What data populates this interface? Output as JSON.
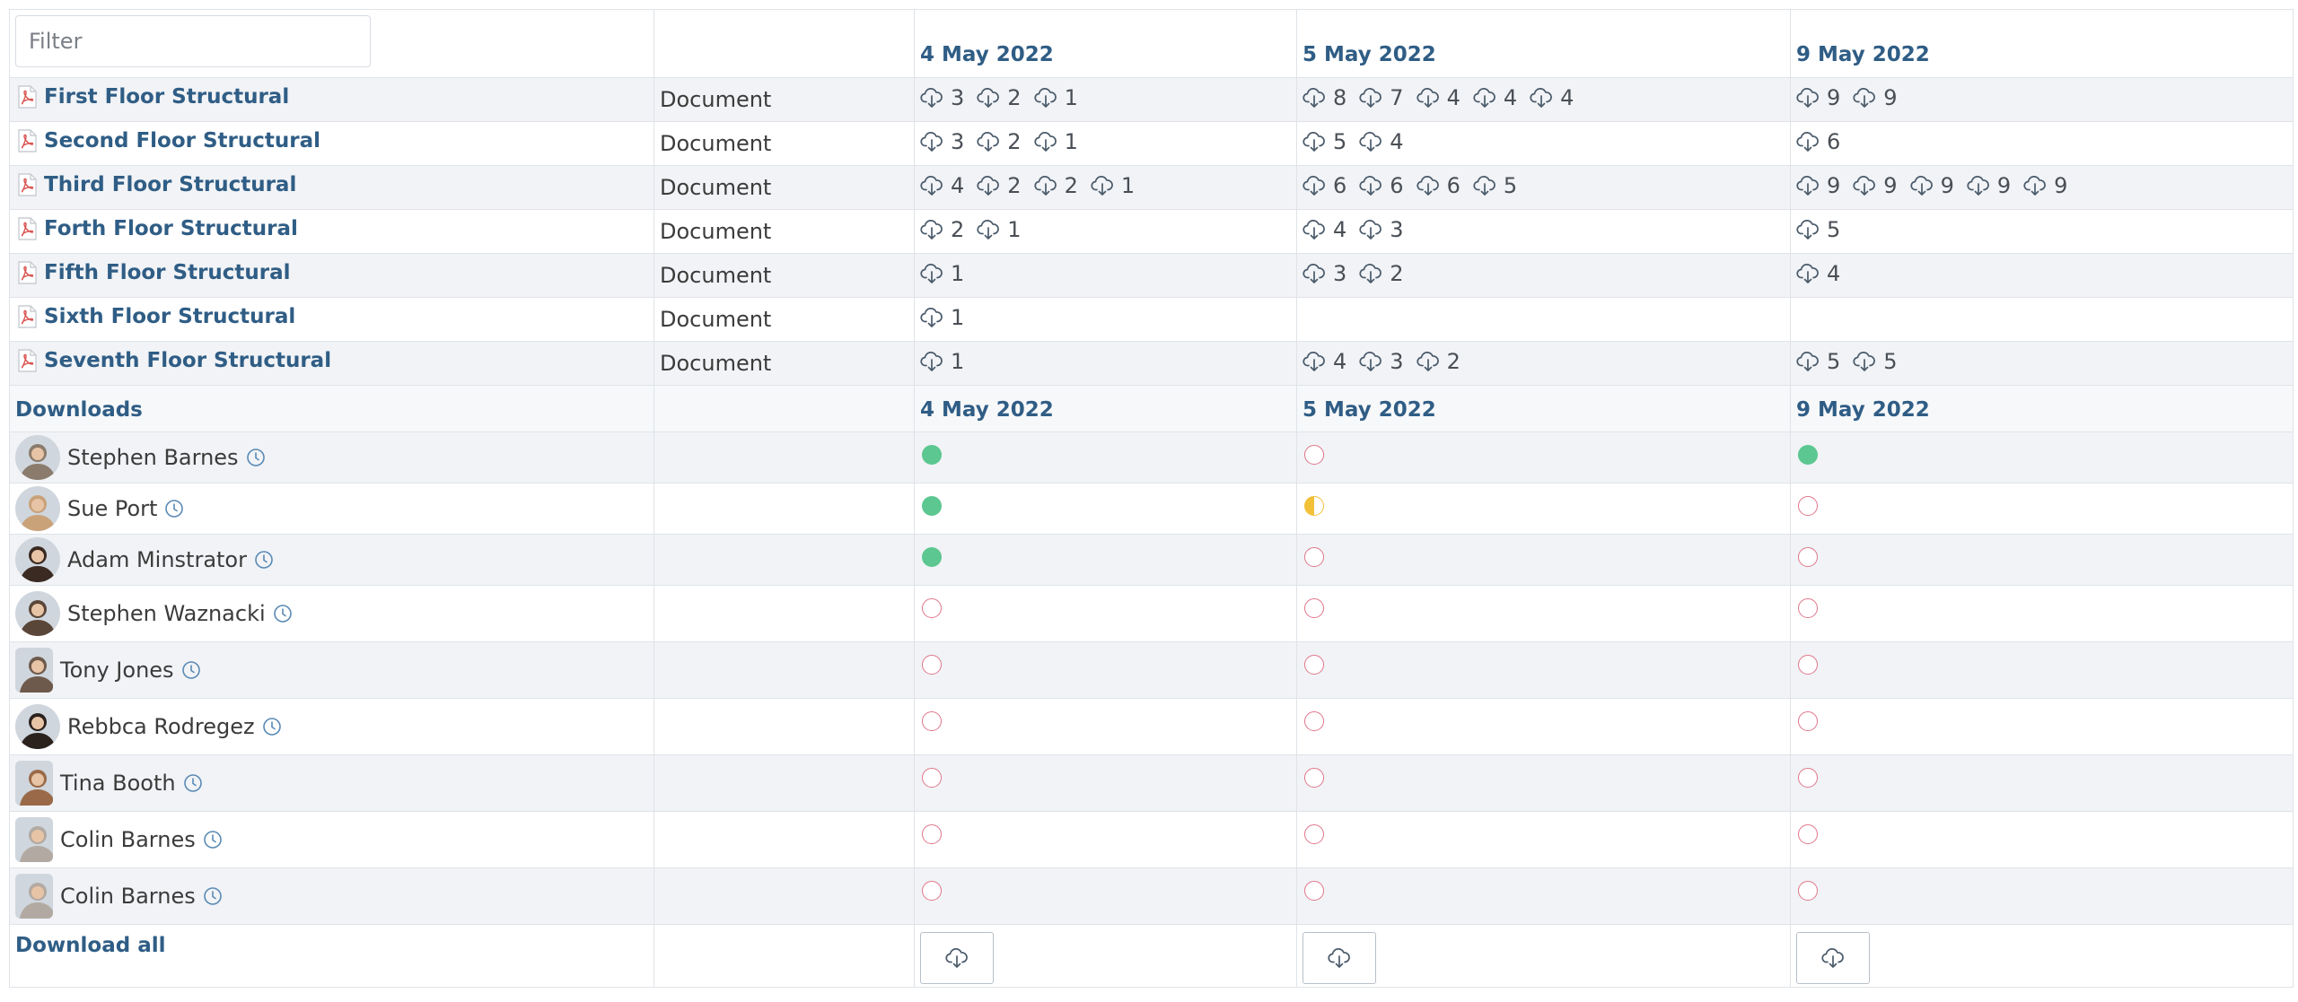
{
  "filter": {
    "placeholder": "Filter"
  },
  "dates": [
    "4 May 2022",
    "5 May 2022",
    "9 May 2022"
  ],
  "documents": [
    {
      "name": "First Floor Structural",
      "type": "Document",
      "downloads": [
        [
          "3",
          "2",
          "1"
        ],
        [
          "8",
          "7",
          "4",
          "4",
          "4"
        ],
        [
          "9",
          "9"
        ]
      ]
    },
    {
      "name": "Second Floor Structural",
      "type": "Document",
      "downloads": [
        [
          "3",
          "2",
          "1"
        ],
        [
          "5",
          "4"
        ],
        [
          "6"
        ]
      ]
    },
    {
      "name": "Third Floor Structural",
      "type": "Document",
      "downloads": [
        [
          "4",
          "2",
          "2",
          "1"
        ],
        [
          "6",
          "6",
          "6",
          "5"
        ],
        [
          "9",
          "9",
          "9",
          "9",
          "9"
        ]
      ]
    },
    {
      "name": "Forth Floor Structural",
      "type": "Document",
      "downloads": [
        [
          "2",
          "1"
        ],
        [
          "4",
          "3"
        ],
        [
          "5"
        ]
      ]
    },
    {
      "name": "Fifth Floor Structural",
      "type": "Document",
      "downloads": [
        [
          "1"
        ],
        [
          "3",
          "2"
        ],
        [
          "4"
        ]
      ]
    },
    {
      "name": "Sixth Floor Structural",
      "type": "Document",
      "downloads": [
        [
          "1"
        ],
        [],
        []
      ]
    },
    {
      "name": "Seventh Floor Structural",
      "type": "Document",
      "downloads": [
        [
          "1"
        ],
        [
          "4",
          "3",
          "2"
        ],
        [
          "5",
          "5"
        ]
      ]
    }
  ],
  "downloads_label": "Downloads",
  "users": [
    {
      "name": "Stephen Barnes",
      "avatar_color": "#8a7b6c",
      "status": [
        "full",
        "empty",
        "full"
      ]
    },
    {
      "name": "Sue Port",
      "avatar_color": "#c9a27a",
      "status": [
        "full",
        "half",
        "empty"
      ]
    },
    {
      "name": "Adam Minstrator",
      "avatar_color": "#3a2a22",
      "status": [
        "full",
        "empty",
        "empty"
      ]
    },
    {
      "name": "Stephen Waznacki",
      "avatar_color": "#5a4638",
      "status": [
        "empty",
        "empty",
        "empty"
      ]
    },
    {
      "name": "Tony Jones",
      "avatar_color": "#6e5a4c",
      "status": [
        "empty",
        "empty",
        "empty"
      ]
    },
    {
      "name": "Rebbca Rodregez",
      "avatar_color": "#2b211d",
      "status": [
        "empty",
        "empty",
        "empty"
      ]
    },
    {
      "name": "Tina Booth",
      "avatar_color": "#9a6a48",
      "status": [
        "empty",
        "empty",
        "empty"
      ]
    },
    {
      "name": "Colin Barnes",
      "avatar_color": "#b2aaa2",
      "status": [
        "empty",
        "empty",
        "empty"
      ]
    },
    {
      "name": "Colin Barnes",
      "avatar_color": "#b2aaa2",
      "status": [
        "empty",
        "empty",
        "empty"
      ]
    }
  ],
  "download_all_label": "Download all",
  "colors": {
    "accent": "#2f5d85",
    "complete": "#5cc790",
    "partial": "#f2c138",
    "none": "#e0758a",
    "pdf": "#d9534f"
  },
  "icons": {
    "document": "pdf-icon",
    "download": "cloud-download-icon",
    "history": "clock-icon"
  }
}
